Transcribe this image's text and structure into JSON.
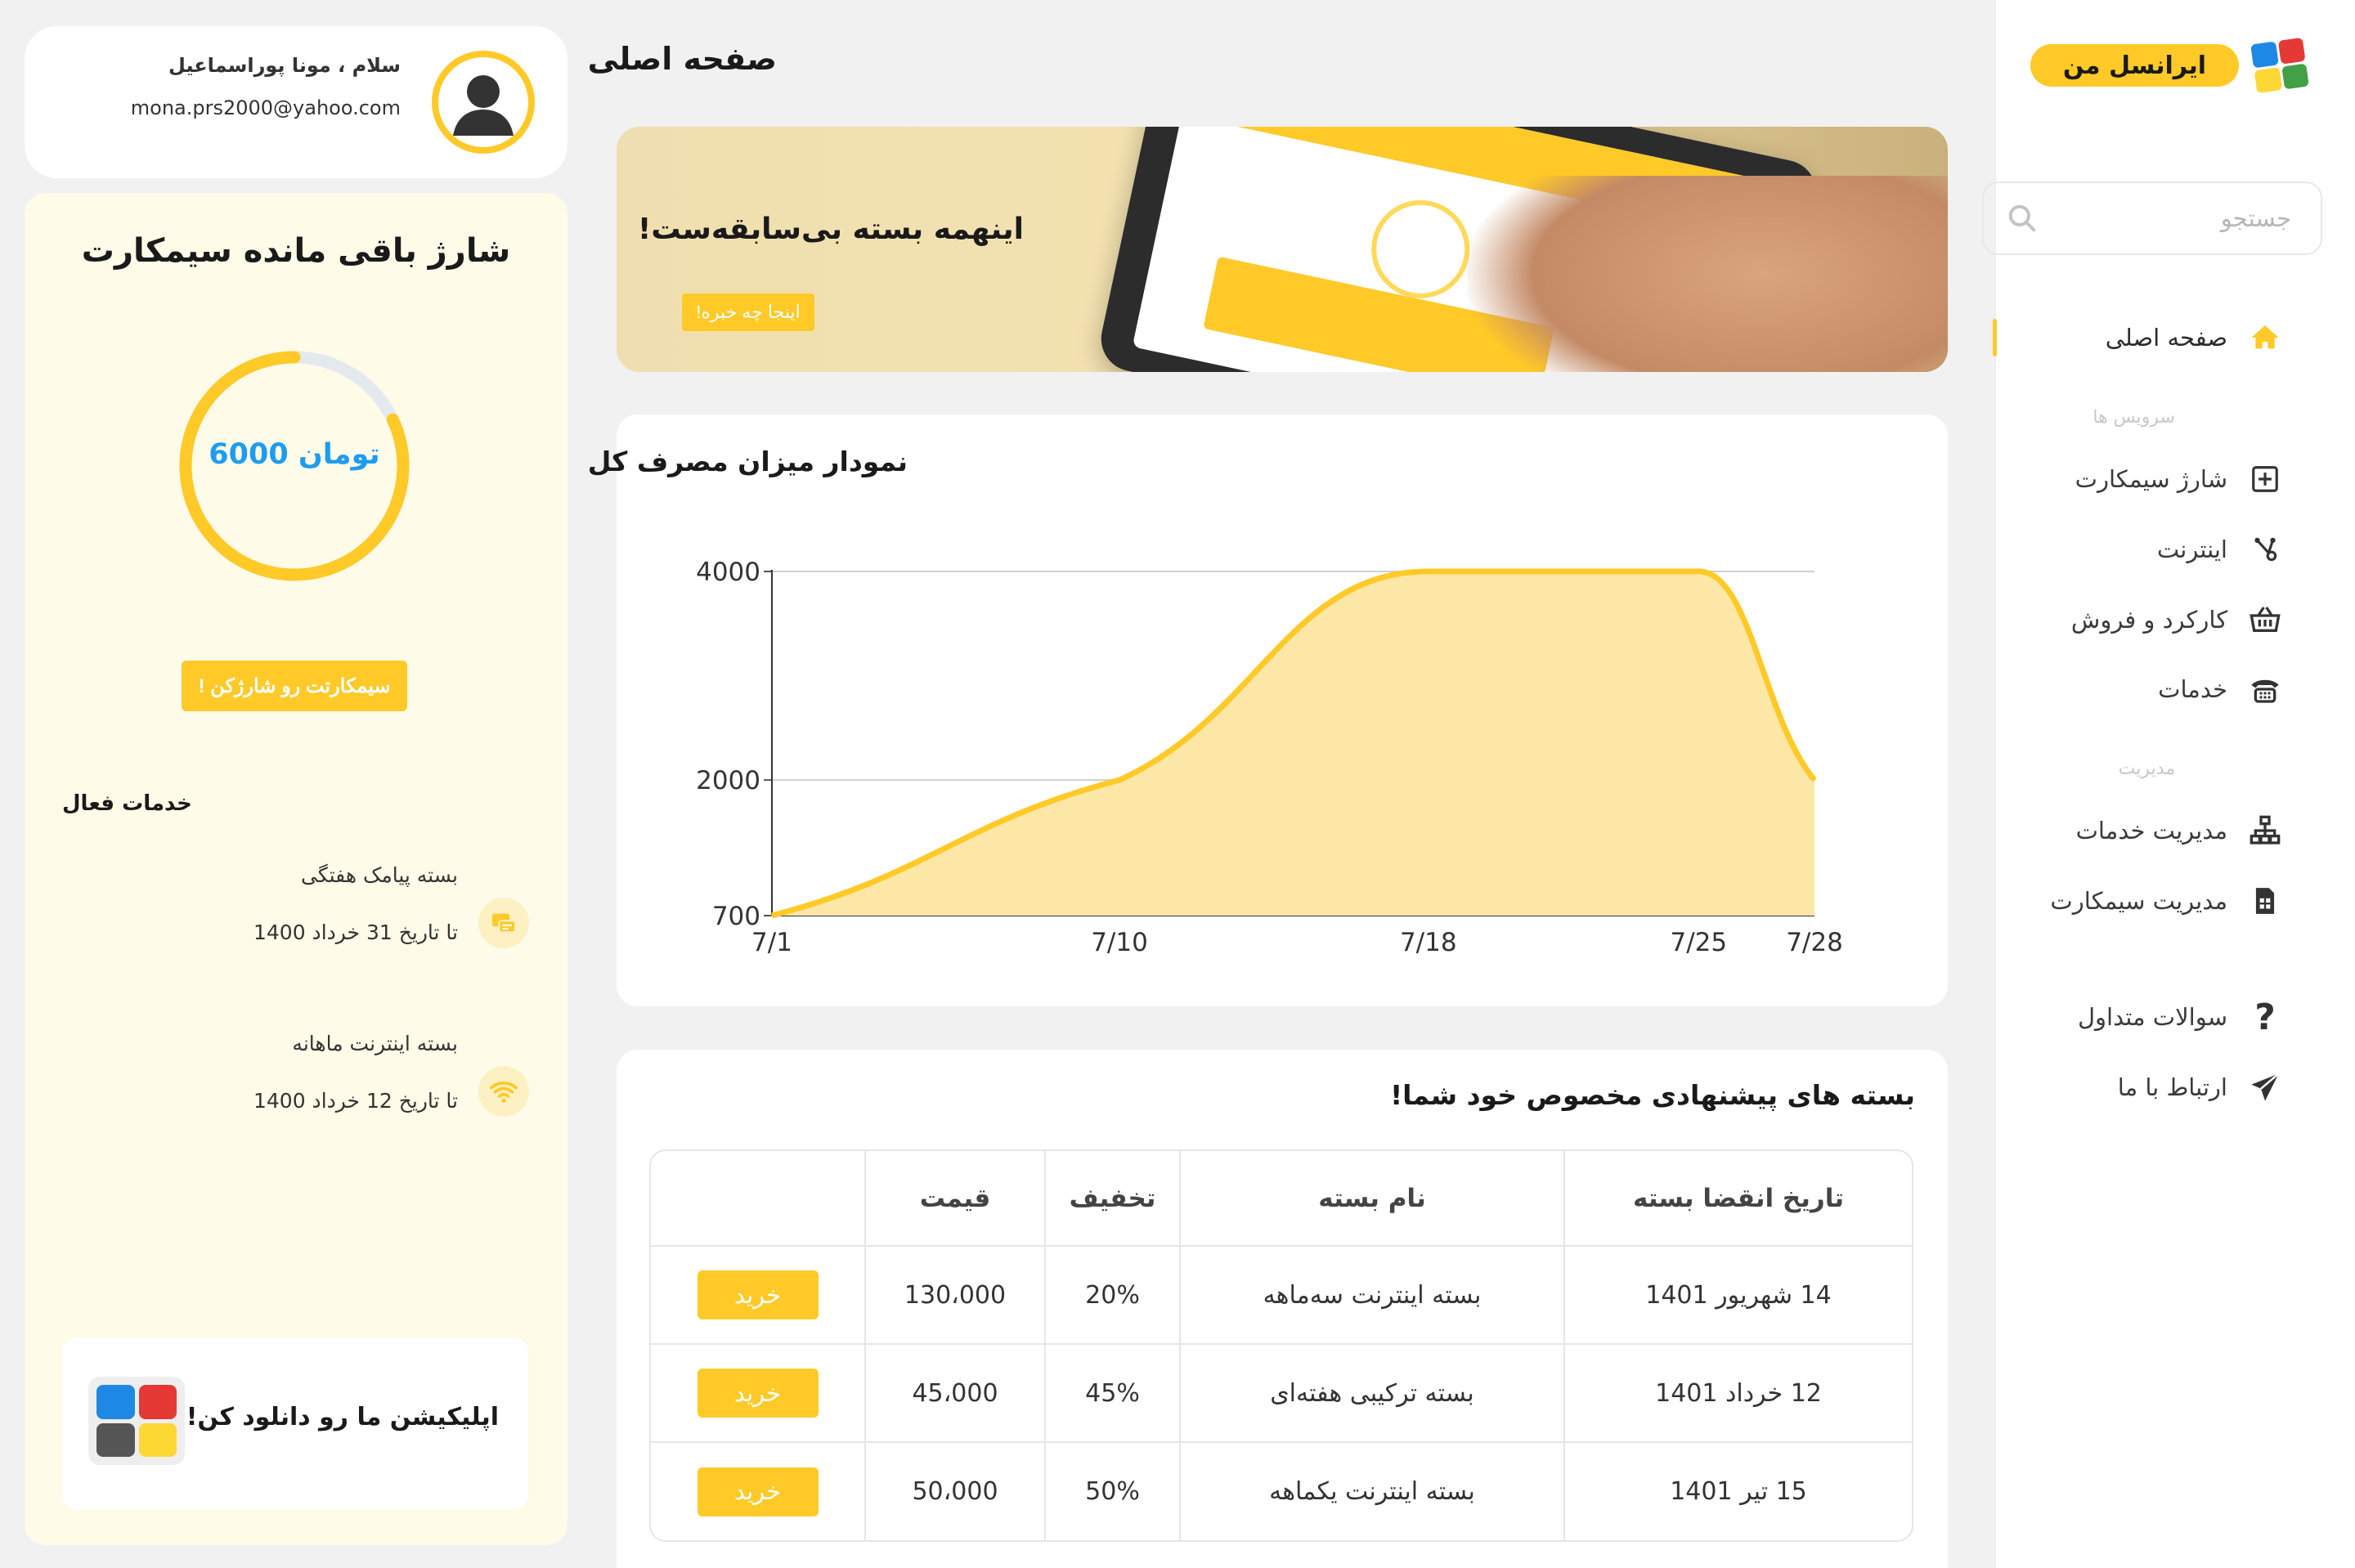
{
  "brand": {
    "name": "ایرانسل من",
    "accent": "#ffc928"
  },
  "search": {
    "placeholder": "جستجو"
  },
  "nav": {
    "home": "صفحه اصلی",
    "section_services": "سرویس ها",
    "services": [
      "شارژ سیمکارت",
      "اینترنت",
      "کارکرد و فروش",
      "خدمات"
    ],
    "section_manage": "مدیریت",
    "manage": [
      "مدیریت خدمات",
      "مدیریت سیمکارت"
    ],
    "extra": [
      "سوالات متداول",
      "ارتباط با ما"
    ],
    "icons": [
      "home-icon",
      "sim-charge-icon",
      "internet-icon",
      "basket-icon",
      "phone-icon",
      "sitemap-icon",
      "sim-card-icon",
      "question-icon",
      "send-icon"
    ]
  },
  "main": {
    "title": "صفحه اصلی",
    "banner": {
      "headline": "اینهمه بسته بی‌سابقه‌ست!",
      "button": "اینجا چه خبره!"
    },
    "usage_chart_title": "نمودار میزان مصرف کل",
    "offers": {
      "title": "!بسته های پیشنهادی مخصوص خود شما",
      "headers": [
        "تاریخ انقضا بسته",
        "نام بسته",
        "تخفیف",
        "قیمت",
        ""
      ],
      "buy_label": "خرید",
      "rows": [
        [
          "14 شهریور 1401",
          "بسته اینترنت سه‌ماهه",
          "20%",
          "130،000"
        ],
        [
          "12 خرداد 1401",
          "بسته ترکیبی هفته‌ای",
          "45%",
          "45،000"
        ],
        [
          "15 تیر 1401",
          "بسته اینترنت یکماهه",
          "50%",
          "50،000"
        ]
      ]
    }
  },
  "user": {
    "greeting": "سلام ، مونا پوراسماعیل",
    "email": "mona.prs2000@yahoo.com"
  },
  "charge": {
    "title": "شارژ باقی مانده سیمکارت",
    "amount": "6000",
    "unit": "تومان",
    "fill_fraction": 0.82,
    "button": "! سیمکارتت رو شارژکن",
    "active_title": "خدمات فعال",
    "active_services": [
      {
        "name": "بسته پیامک هفتگی",
        "until": "تا تاریخ 31 خرداد 1400",
        "icon": "sms-icon"
      },
      {
        "name": "بسته اینترنت ماهانه",
        "until": "تا تاریخ 12 خرداد 1400",
        "icon": "wifi-icon"
      }
    ],
    "download": "اپلیکیشن ما رو دانلود کن!"
  },
  "chart_data": {
    "type": "area",
    "title": "نمودار میزان مصرف کل",
    "x": [
      "7/1",
      "7/10",
      "7/18",
      "7/25",
      "7/28"
    ],
    "values": [
      700,
      2000,
      4000,
      4000,
      2000
    ],
    "yticks": [
      700,
      2000,
      4000
    ],
    "ylim": [
      700,
      4000
    ],
    "grid": true,
    "color": "#ffc928",
    "fill": "#fde7a7"
  }
}
